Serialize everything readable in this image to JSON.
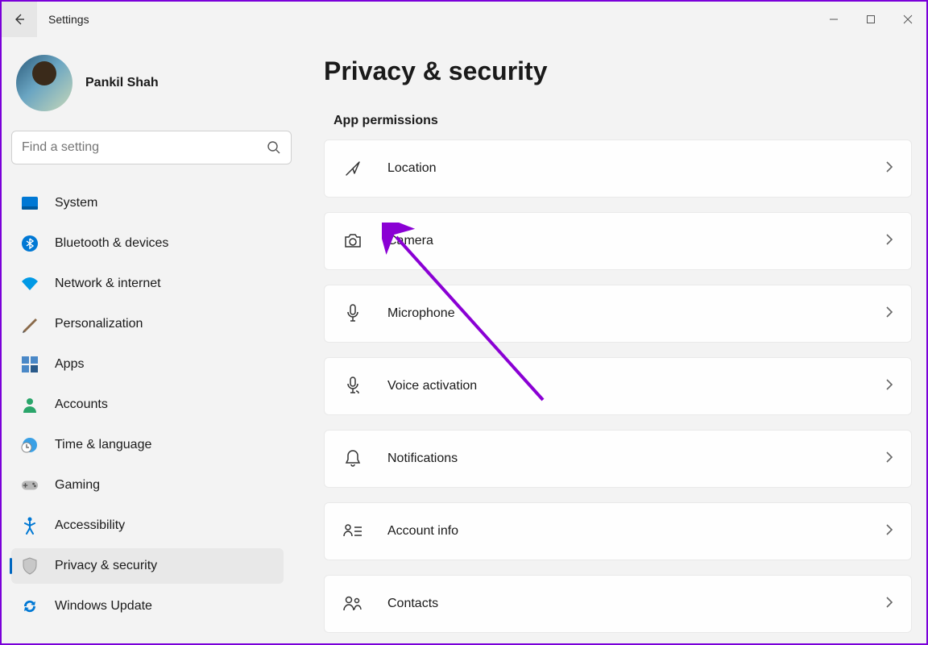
{
  "header": {
    "app_title": "Settings"
  },
  "profile": {
    "name": "Pankil Shah"
  },
  "search": {
    "placeholder": "Find a setting"
  },
  "nav": [
    {
      "id": "system",
      "label": "System"
    },
    {
      "id": "bluetooth",
      "label": "Bluetooth & devices"
    },
    {
      "id": "network",
      "label": "Network & internet"
    },
    {
      "id": "personalization",
      "label": "Personalization"
    },
    {
      "id": "apps",
      "label": "Apps"
    },
    {
      "id": "accounts",
      "label": "Accounts"
    },
    {
      "id": "time",
      "label": "Time & language"
    },
    {
      "id": "gaming",
      "label": "Gaming"
    },
    {
      "id": "accessibility",
      "label": "Accessibility"
    },
    {
      "id": "privacy",
      "label": "Privacy & security",
      "selected": true
    },
    {
      "id": "update",
      "label": "Windows Update"
    }
  ],
  "page": {
    "title": "Privacy & security",
    "section": "App permissions",
    "items": [
      {
        "id": "location",
        "label": "Location"
      },
      {
        "id": "camera",
        "label": "Camera"
      },
      {
        "id": "microphone",
        "label": "Microphone"
      },
      {
        "id": "voice",
        "label": "Voice activation"
      },
      {
        "id": "notifications",
        "label": "Notifications"
      },
      {
        "id": "account-info",
        "label": "Account info"
      },
      {
        "id": "contacts",
        "label": "Contacts"
      }
    ]
  }
}
